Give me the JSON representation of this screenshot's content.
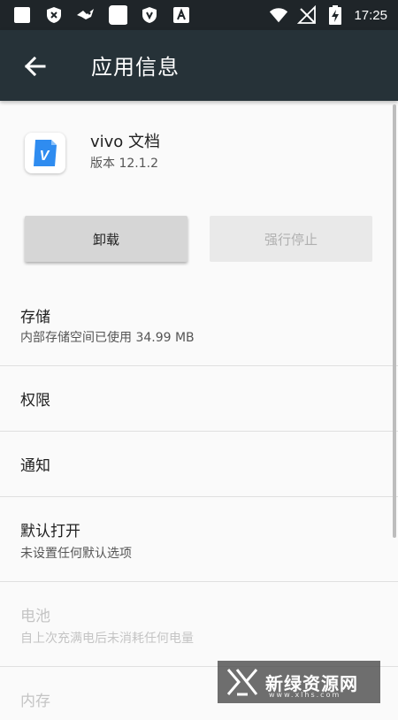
{
  "status_bar": {
    "time": "17:25",
    "icons": [
      "notification-square-icon",
      "shield-x-icon",
      "bird-icon",
      "notification-square-icon",
      "shield-v-icon",
      "a-box-icon",
      "wifi-icon",
      "no-sim-icon",
      "battery-charging-icon"
    ]
  },
  "app_bar": {
    "title": "应用信息"
  },
  "app": {
    "name": "vivo 文档",
    "version": "版本 12.1.2",
    "icon_letter": "V",
    "icon_color": "#2f8cf0"
  },
  "buttons": {
    "uninstall": "卸载",
    "force_stop": "强行停止"
  },
  "items": [
    {
      "title": "存储",
      "subtitle": "内部存储空间已使用 34.99 MB",
      "enabled": true
    },
    {
      "title": "权限",
      "subtitle": "",
      "enabled": true
    },
    {
      "title": "通知",
      "subtitle": "",
      "enabled": true
    },
    {
      "title": "默认打开",
      "subtitle": "未设置任何默认选项",
      "enabled": true
    },
    {
      "title": "电池",
      "subtitle": "自上次充满电后未消耗任何电量",
      "enabled": false
    },
    {
      "title": "内存",
      "subtitle": "",
      "enabled": false
    }
  ],
  "watermark": {
    "text": "新绿资源网",
    "url": "www.xlhs.com"
  },
  "colors": {
    "app_bar": "#263238",
    "status_bar": "#1f2529",
    "background": "#fafafa"
  }
}
